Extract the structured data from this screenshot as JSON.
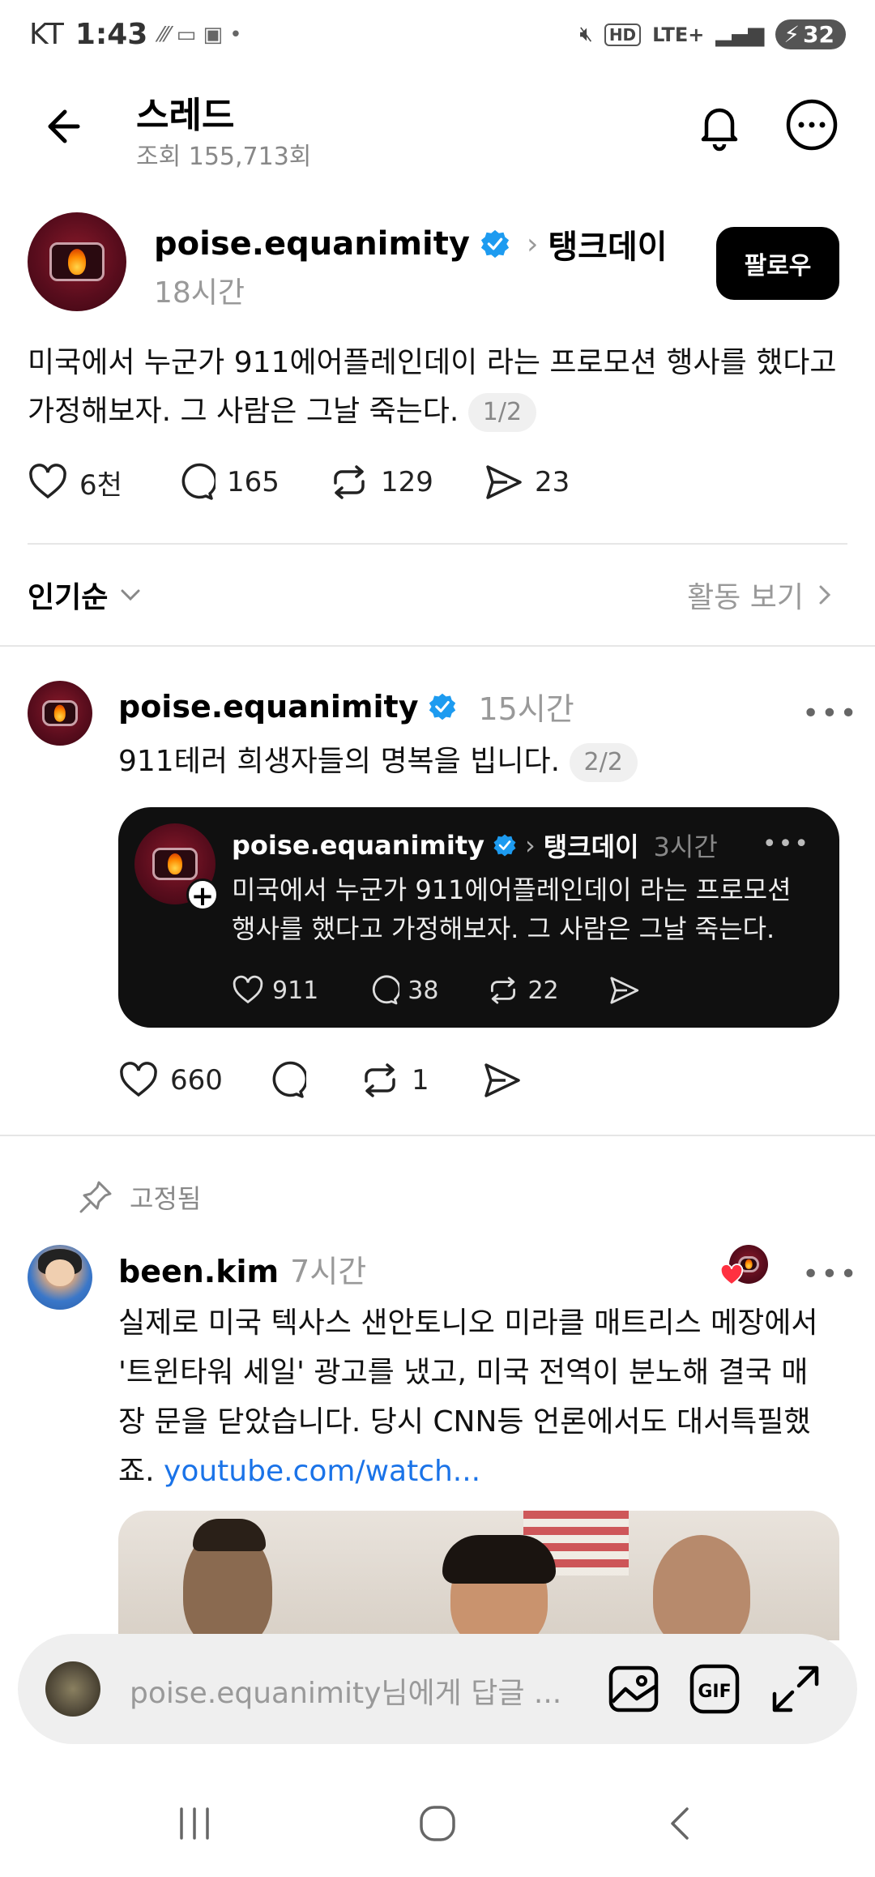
{
  "status_bar": {
    "carrier": "KT",
    "time": "1:43",
    "network": "LTE+",
    "battery": "32"
  },
  "header": {
    "title": "스레드",
    "views": "조회 155,713회"
  },
  "main_post": {
    "username": "poise.equanimity",
    "topic": "탱크데이",
    "time": "18시간",
    "follow_label": "팔로우",
    "text": "미국에서 누군가 911에어플레인데이 라는 프로모션 행사를 했다고 가정해보자. 그 사람은 그날 죽는다.",
    "thread_index": "1/2",
    "likes": "6천",
    "replies": "165",
    "reposts": "129",
    "shares": "23"
  },
  "sort": {
    "label": "인기순",
    "activity_label": "활동 보기"
  },
  "reply_post": {
    "username": "poise.equanimity",
    "time": "15시간",
    "text": "911테러 희생자들의 명복을 빕니다.",
    "thread_index": "2/2",
    "likes": "660",
    "reposts": "1",
    "quote": {
      "username": "poise.equanimity",
      "topic": "탱크데이",
      "time": "3시간",
      "text": "미국에서 누군가 911에어플레인데이 라는 프로모션 행사를 했다고 가정해보자. 그 사람은 그날 죽는다.",
      "likes": "911",
      "replies": "38",
      "reposts": "22"
    }
  },
  "pinned_post": {
    "pinned_label": "고정됨",
    "username": "been.kim",
    "time": "7시간",
    "text": "실제로 미국 텍사스 샌안토니오 미라클 매트리스 메장에서 '트윈타워 세일' 광고를 냈고, 미국 전역이 분노해 결국 매장 문을 닫았습니다. 당시 CNN등 언론에서도 대서특필했죠.",
    "link": "youtube.com/watch..."
  },
  "reply_bar": {
    "placeholder": "poise.equanimity님에게 답글 ..."
  },
  "colors": {
    "verified": "#1d9bf0",
    "link": "#1a73e8",
    "follow_bg": "#000000",
    "quote_bg": "#101010"
  }
}
